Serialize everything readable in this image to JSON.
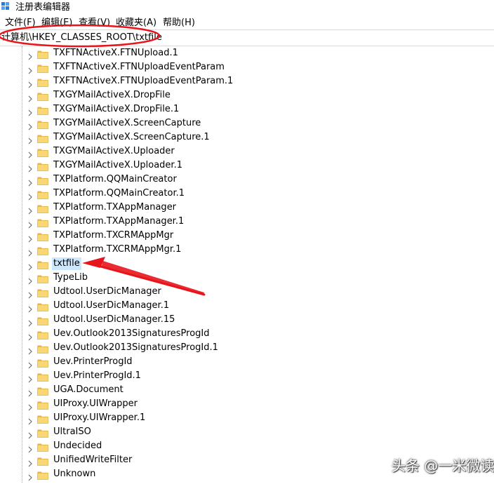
{
  "window": {
    "title": "注册表编辑器"
  },
  "menu": [
    {
      "label": "文件(F)"
    },
    {
      "label": "编辑(E)"
    },
    {
      "label": "查看(V)"
    },
    {
      "label": "收藏夹(A)"
    },
    {
      "label": "帮助(H)"
    }
  ],
  "address": {
    "path": "计算机\\HKEY_CLASSES_ROOT\\txtfile"
  },
  "tree": {
    "items": [
      {
        "label": "TXFTNActiveX.FTNUpload.1"
      },
      {
        "label": "TXFTNActiveX.FTNUploadEventParam"
      },
      {
        "label": "TXFTNActiveX.FTNUploadEventParam.1"
      },
      {
        "label": "TXGYMailActiveX.DropFile"
      },
      {
        "label": "TXGYMailActiveX.DropFile.1"
      },
      {
        "label": "TXGYMailActiveX.ScreenCapture"
      },
      {
        "label": "TXGYMailActiveX.ScreenCapture.1"
      },
      {
        "label": "TXGYMailActiveX.Uploader"
      },
      {
        "label": "TXGYMailActiveX.Uploader.1"
      },
      {
        "label": "TXPlatform.QQMainCreator"
      },
      {
        "label": "TXPlatform.QQMainCreator.1"
      },
      {
        "label": "TXPlatform.TXAppManager"
      },
      {
        "label": "TXPlatform.TXAppManager.1"
      },
      {
        "label": "TXPlatform.TXCRMAppMgr"
      },
      {
        "label": "TXPlatform.TXCRMAppMgr.1"
      },
      {
        "label": "txtfile",
        "selected": true
      },
      {
        "label": "TypeLib"
      },
      {
        "label": "Udtool.UserDicManager"
      },
      {
        "label": "Udtool.UserDicManager.1"
      },
      {
        "label": "Udtool.UserDicManager.15"
      },
      {
        "label": "Uev.Outlook2013SignaturesProgId"
      },
      {
        "label": "Uev.Outlook2013SignaturesProgId.1"
      },
      {
        "label": "Uev.PrinterProgId"
      },
      {
        "label": "Uev.PrinterProgId.1"
      },
      {
        "label": "UGA.Document"
      },
      {
        "label": "UIProxy.UIWrapper"
      },
      {
        "label": "UIProxy.UIWrapper.1"
      },
      {
        "label": "UltraISO"
      },
      {
        "label": "Undecided"
      },
      {
        "label": "UnifiedWriteFilter"
      },
      {
        "label": "Unknown"
      }
    ]
  },
  "watermark": {
    "text": "头条 @一米微读"
  },
  "colors": {
    "annotation_red": "#e8141c",
    "selection": "#cce8ff",
    "folder": "#f8d775",
    "folder_dark": "#e5b446"
  },
  "icons": {
    "app": "regedit-icon",
    "expand": "chevron-right-icon",
    "node": "folder-icon"
  }
}
